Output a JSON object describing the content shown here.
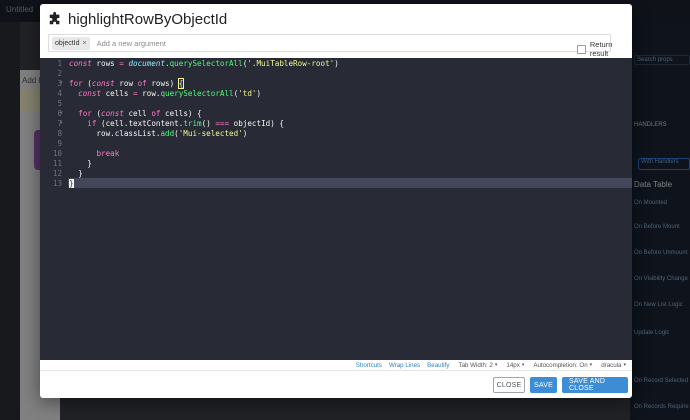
{
  "background": {
    "topbar_text": "Untitled",
    "add_label": "Add l",
    "right_panel": {
      "search_placeholder": "Search props",
      "button_label": "With Handlers",
      "tab_label": "HANDLERS",
      "section_title": "Data Table",
      "items": [
        "On Mounted",
        "On Before Mount",
        "On Before Unmount",
        "On Visibility Change",
        "On New List Logic",
        "Update Logic",
        "On Record Selected",
        "On Records Require"
      ]
    }
  },
  "modal": {
    "title": "highlightRowByObjectId",
    "arguments": {
      "chips": [
        "objectId"
      ],
      "chip_remove_glyph": "×",
      "placeholder": "Add a new argument"
    },
    "return_result_label": "Return result",
    "editor": {
      "line_numbers": [
        "1",
        "2",
        "3",
        "4",
        "5",
        "6",
        "7",
        "8",
        "9",
        "10",
        "11",
        "12",
        "13"
      ],
      "fold_glyph": "▾"
    },
    "statusbar": {
      "shortcuts": "Shortcuts",
      "wrap_lines": "Wrap Lines",
      "beautify": "Beautify",
      "tab_width": "Tab Width: 2",
      "font_size": "14px",
      "autocompletion": "Autocompletion: On",
      "theme": "dracula",
      "caret": "▾"
    },
    "footer": {
      "close": "CLOSE",
      "save": "SAVE",
      "save_and_close": "SAVE AND CLOSE"
    }
  },
  "colors": {
    "editor_bg": "#282a36",
    "active_line": "#44475a",
    "keyword": "#ff79c6",
    "string": "#f1fa8c",
    "function": "#50fa7b",
    "primary_button": "#3c8dd6"
  },
  "icons": {
    "title_icon": "puzzle-piece-icon"
  }
}
